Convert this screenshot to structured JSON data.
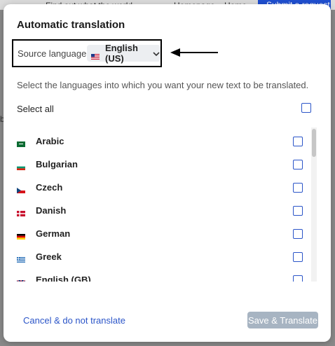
{
  "background": {
    "text1": "Find out what the world",
    "text2": "Homepage",
    "text3": "Home",
    "button": "Submit a request",
    "side_char": "b"
  },
  "modal": {
    "title": "Automatic translation",
    "source_label": "Source language:",
    "source_value": "English (US)",
    "source_flag": "us-flag-icon",
    "instructions": "Select the languages into which you want your new text to be translated.",
    "select_all_label": "Select all",
    "languages": [
      {
        "name": "Arabic",
        "flag": "sa-flag-icon"
      },
      {
        "name": "Bulgarian",
        "flag": "bg-flag-icon"
      },
      {
        "name": "Czech",
        "flag": "cz-flag-icon"
      },
      {
        "name": "Danish",
        "flag": "dk-flag-icon"
      },
      {
        "name": "German",
        "flag": "de-flag-icon"
      },
      {
        "name": "Greek",
        "flag": "gr-flag-icon"
      },
      {
        "name": "English (GB)",
        "flag": "gb-flag-icon"
      }
    ],
    "cancel_label": "Cancel & do not translate",
    "save_label": "Save & Translate"
  },
  "colors": {
    "accent": "#2b55c8",
    "disabled_button": "#a7b4c2"
  }
}
